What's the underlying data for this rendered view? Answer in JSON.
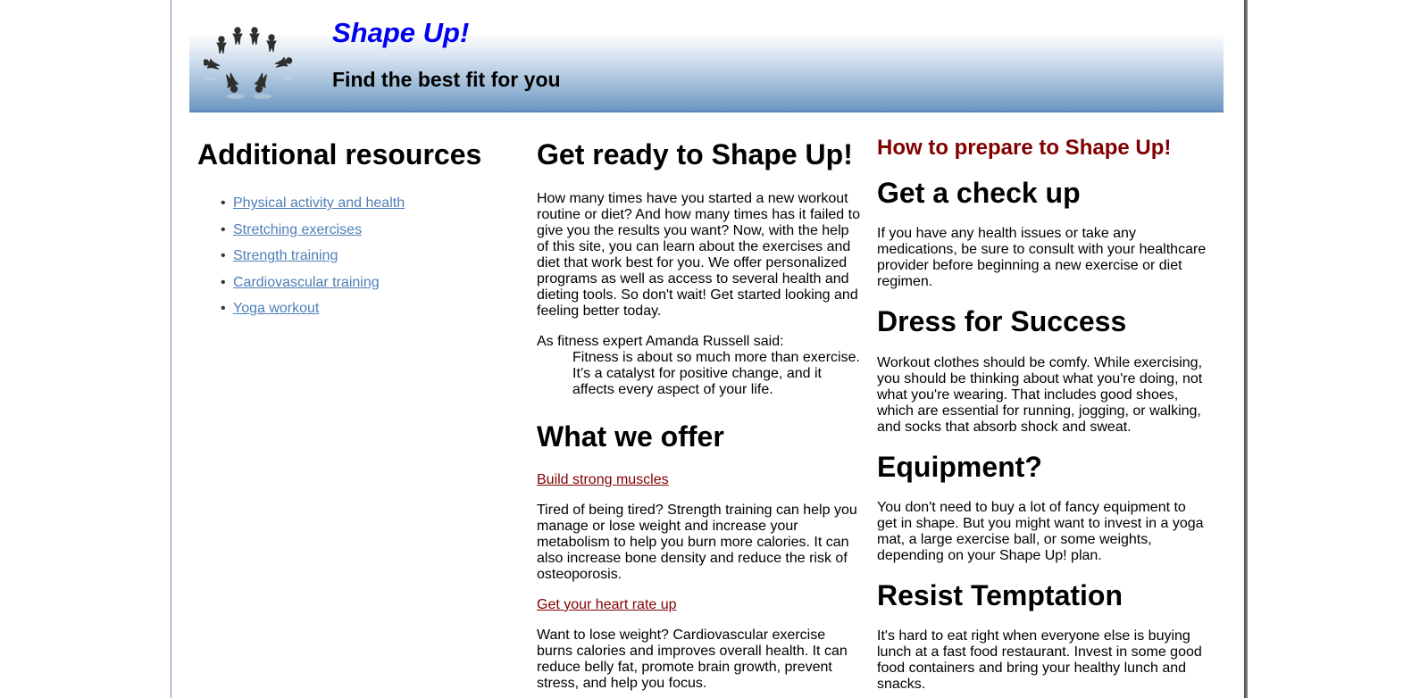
{
  "header": {
    "title": "Shape Up!",
    "tagline": "Find the best fit for you",
    "logo_icon": "people-circle-logo",
    "colors": {
      "title": "#0000ee",
      "band_bottom": "#6d96c2"
    }
  },
  "sidebar": {
    "heading": "Additional resources",
    "links": [
      "Physical activity and health",
      "Stretching exercises",
      "Strength training",
      "Cardiovascular training",
      "Yoga workout"
    ],
    "link_color": "#4e7eb8"
  },
  "main": {
    "heading": "Get ready to Shape Up!",
    "intro": "How many times have you started a new workout routine or diet? And how many times has it failed to give you the results you want? Now, with the help of this site, you can learn about the exercises and diet that work best for you. We offer personalized programs as well as access to several health and dieting tools. So don't wait! Get started looking and feeling better today.",
    "quote_intro": "As fitness expert Amanda Russell said:",
    "quote": "Fitness is about so much more than exercise. It’s a catalyst for positive change, and it affects every aspect of your life.",
    "offer_heading": "What we offer",
    "offer1_link": "Build strong muscles",
    "offer1_text": "Tired of being tired? Strength training can help you manage or lose weight and increase your metabolism to help you burn more calories. It can also increase bone density and reduce the risk of osteoporosis.",
    "offer2_link": "Get your heart rate up",
    "offer2_text": "Want to lose weight? Cardiovascular exercise burns calories and improves overall health. It can reduce belly fat, promote brain growth, prevent stress, and help you focus."
  },
  "prepare": {
    "title": "How to prepare to Shape Up!",
    "title_color": "#800000",
    "sections": [
      {
        "heading": "Get a check up",
        "text": "If you have any health issues or take any medications, be sure to consult with your healthcare provider before beginning a new exercise or diet regimen."
      },
      {
        "heading": "Dress for Success",
        "text": "Workout clothes should be comfy. While exercising, you should be thinking about what you're doing, not what you're wearing. That includes good shoes, which are essential for running, jogging, or walking, and socks that absorb shock and sweat."
      },
      {
        "heading": "Equipment?",
        "text": "You don't need to buy a lot of fancy equipment to get in shape. But you might want to invest in a yoga mat, a large exercise ball, or some weights, depending on your Shape Up! plan."
      },
      {
        "heading": "Resist Temptation",
        "text": "It's hard to eat right when everyone else is buying lunch at a fast food restaurant. Invest in some good food containers and bring your healthy lunch and snacks."
      }
    ]
  }
}
